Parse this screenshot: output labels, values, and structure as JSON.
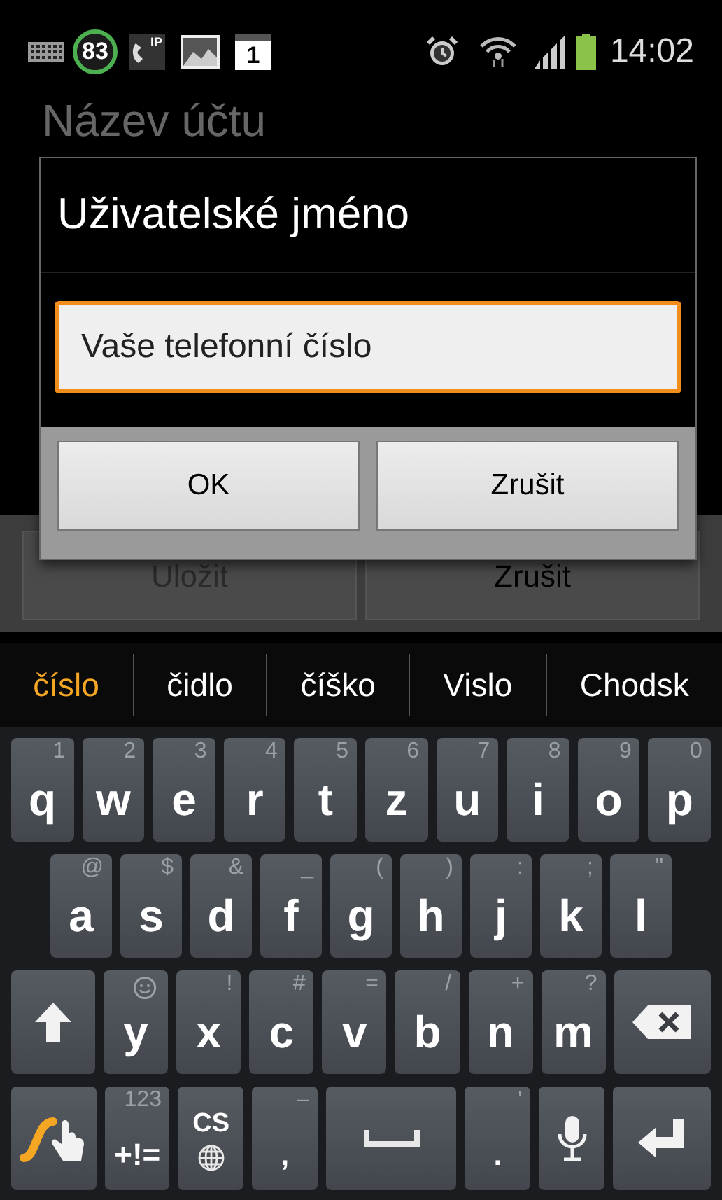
{
  "status_bar": {
    "notification_count": "83",
    "call_badge": "IP",
    "calendar_day": "1",
    "time": "14:02"
  },
  "background": {
    "field_label": "Název účtu",
    "buttons": [
      {
        "label": "Uložit",
        "disabled": true
      },
      {
        "label": "Zrušit",
        "disabled": false
      }
    ]
  },
  "dialog": {
    "title": "Uživatelské jméno",
    "input": {
      "value": "Vaše telefonní číslo",
      "focused": true
    },
    "buttons": [
      "OK",
      "Zrušit"
    ]
  },
  "suggestions": [
    {
      "text": "číslo",
      "selected": true
    },
    {
      "text": "čidlo",
      "selected": false
    },
    {
      "text": "číško",
      "selected": false
    },
    {
      "text": "Vislo",
      "selected": false
    },
    {
      "text": "Chodsk",
      "selected": false
    }
  ],
  "keyboard": {
    "rows": [
      {
        "keys": [
          {
            "kind": "char",
            "label": "q",
            "hint": "1"
          },
          {
            "kind": "char",
            "label": "w",
            "hint": "2"
          },
          {
            "kind": "char",
            "label": "e",
            "hint": "3"
          },
          {
            "kind": "char",
            "label": "r",
            "hint": "4"
          },
          {
            "kind": "char",
            "label": "t",
            "hint": "5"
          },
          {
            "kind": "char",
            "label": "z",
            "hint": "6"
          },
          {
            "kind": "char",
            "label": "u",
            "hint": "7"
          },
          {
            "kind": "char",
            "label": "i",
            "hint": "8"
          },
          {
            "kind": "char",
            "label": "o",
            "hint": "9"
          },
          {
            "kind": "char",
            "label": "p",
            "hint": "0"
          }
        ]
      },
      {
        "keys": [
          {
            "kind": "char",
            "label": "a",
            "hint": "@"
          },
          {
            "kind": "char",
            "label": "s",
            "hint": "$"
          },
          {
            "kind": "char",
            "label": "d",
            "hint": "&"
          },
          {
            "kind": "char",
            "label": "f",
            "hint": "_"
          },
          {
            "kind": "char",
            "label": "g",
            "hint": "("
          },
          {
            "kind": "char",
            "label": "h",
            "hint": ")"
          },
          {
            "kind": "char",
            "label": "j",
            "hint": ":"
          },
          {
            "kind": "char",
            "label": "k",
            "hint": ";"
          },
          {
            "kind": "char",
            "label": "l",
            "hint": "\""
          }
        ]
      },
      {
        "keys": [
          {
            "kind": "shift"
          },
          {
            "kind": "emoji-char",
            "label": "y"
          },
          {
            "kind": "char",
            "label": "x",
            "hint": "!"
          },
          {
            "kind": "char",
            "label": "c",
            "hint": "#"
          },
          {
            "kind": "char",
            "label": "v",
            "hint": "="
          },
          {
            "kind": "char",
            "label": "b",
            "hint": "/"
          },
          {
            "kind": "char",
            "label": "n",
            "hint": "+"
          },
          {
            "kind": "char",
            "label": "m",
            "hint": "?"
          },
          {
            "kind": "backspace"
          }
        ]
      },
      {
        "keys": [
          {
            "kind": "swype"
          },
          {
            "kind": "char",
            "label": "+!=",
            "hint": "123"
          },
          {
            "kind": "language",
            "label": "CS"
          },
          {
            "kind": "char",
            "label": ",",
            "hint": "–"
          },
          {
            "kind": "space"
          },
          {
            "kind": "char",
            "label": ".",
            "hint": "'"
          },
          {
            "kind": "mic"
          },
          {
            "kind": "enter"
          }
        ]
      }
    ]
  }
}
